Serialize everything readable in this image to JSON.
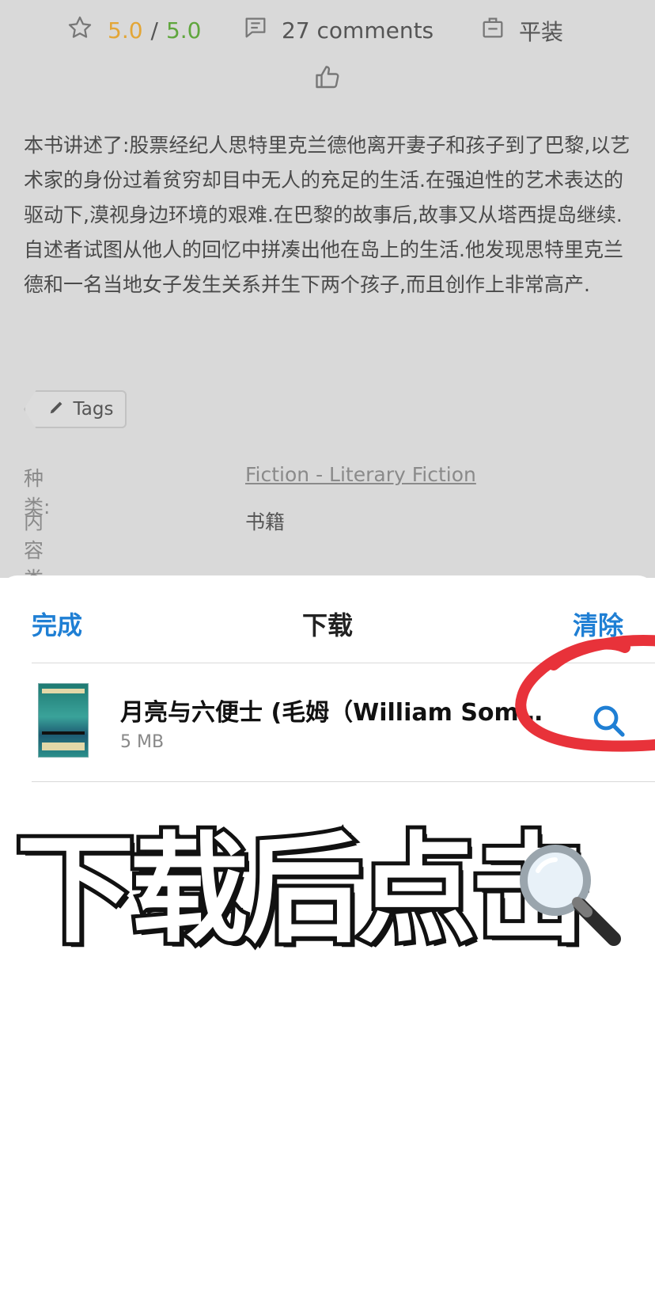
{
  "stats": {
    "rating_value": "5.0",
    "rating_separator": "/",
    "rating_max": "5.0",
    "comments": "27 comments",
    "format": "平装"
  },
  "description": "本书讲述了:股票经纪人思特里克兰德他离开妻子和孩子到了巴黎,以艺术家的身份过着贫穷却目中无人的充足的生活.在强迫性的艺术表达的驱动下,漠视身边环境的艰难.在巴黎的故事后,故事又从塔西提岛继续.自述者试图从他人的回忆中拼凑出他在岛上的生活.他发现思特里克兰德和一名当地女子发生关系并生下两个孩子,而且创作上非常高产.",
  "tags_label": "Tags",
  "meta": {
    "category_label": "种类:",
    "category_value": "Fiction - Literary Fiction",
    "content_type_label": "内容类型:",
    "content_type_value": "书籍"
  },
  "sheet": {
    "done_label": "完成",
    "title": "下载",
    "clear_label": "清除",
    "item": {
      "title": "月亮与六便士 (毛姆（William Som…",
      "size": "5 MB"
    }
  },
  "overlay_caption": "下载后点击",
  "colors": {
    "accent_blue": "#1f7fd4",
    "rating_orange": "#e3a637",
    "rating_green": "#5fa63d",
    "annotation_red": "#e8323a"
  },
  "icons": [
    "star-icon",
    "comment-icon",
    "bag-icon",
    "thumbs-up-icon",
    "pencil-icon",
    "search-icon",
    "magnifier-emoji-icon"
  ]
}
